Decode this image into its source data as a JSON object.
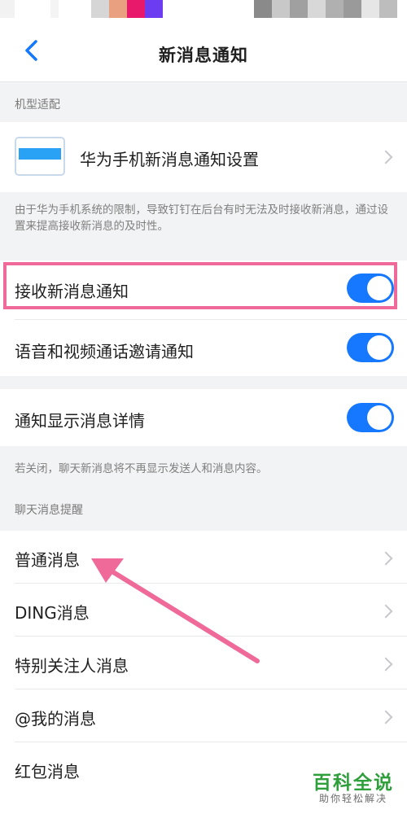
{
  "header": {
    "title": "新消息通知"
  },
  "sections": {
    "device": {
      "label": "机型适配",
      "item_label": "华为手机新消息通知设置"
    },
    "device_note": "由于华为手机系统的限制，导致钉钉在后台有时无法及时接收新消息，通过设置来提高接收新消息的及时性。",
    "toggles": [
      {
        "label": "接收新消息通知",
        "on": true
      },
      {
        "label": "语音和视频通话邀请通知",
        "on": true
      }
    ],
    "detail_toggle": {
      "label": "通知显示消息详情",
      "on": true
    },
    "detail_note": "若关闭，聊天新消息将不再显示发送人和消息内容。",
    "chat": {
      "label": "聊天消息提醒",
      "items": [
        {
          "label": "普通消息"
        },
        {
          "label": "DING消息"
        },
        {
          "label": "特别关注人消息"
        },
        {
          "label": "@我的消息"
        },
        {
          "label": "红包消息"
        }
      ]
    }
  },
  "watermark": {
    "main": "百科全说",
    "sub": "助你轻松解决"
  },
  "colors": {
    "accent": "#1677ff",
    "highlight": "#ef6a99",
    "watermark": "#2e9f3b"
  }
}
